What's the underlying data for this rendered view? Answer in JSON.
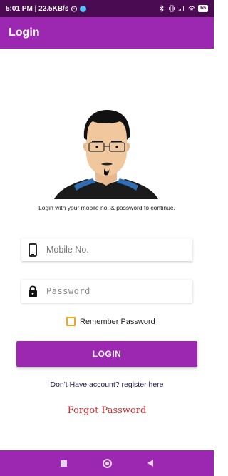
{
  "status_bar": {
    "time_speed": "5:01 PM | 22.5KB/s",
    "battery": "65"
  },
  "app_bar": {
    "title": "Login"
  },
  "content": {
    "subtitle": "Login with your mobile no. & password to continue.",
    "mobile_placeholder": "Mobile No.",
    "password_placeholder": "Password",
    "remember_label": "Remember Password",
    "remember_checked": false,
    "login_label": "LOGIN",
    "register_text": "Don't Have account? register here",
    "forgot_text": "Forgot Password"
  },
  "colors": {
    "primary": "#9c27b0",
    "status_bar": "#4a0b52",
    "checkbox": "#f2a51a",
    "forgot": "#d32f2f"
  },
  "icons": {
    "mobile": "phone-icon",
    "password": "lock-icon",
    "nav_recents": "square-icon",
    "nav_home": "circle-icon",
    "nav_back": "triangle-back-icon"
  }
}
